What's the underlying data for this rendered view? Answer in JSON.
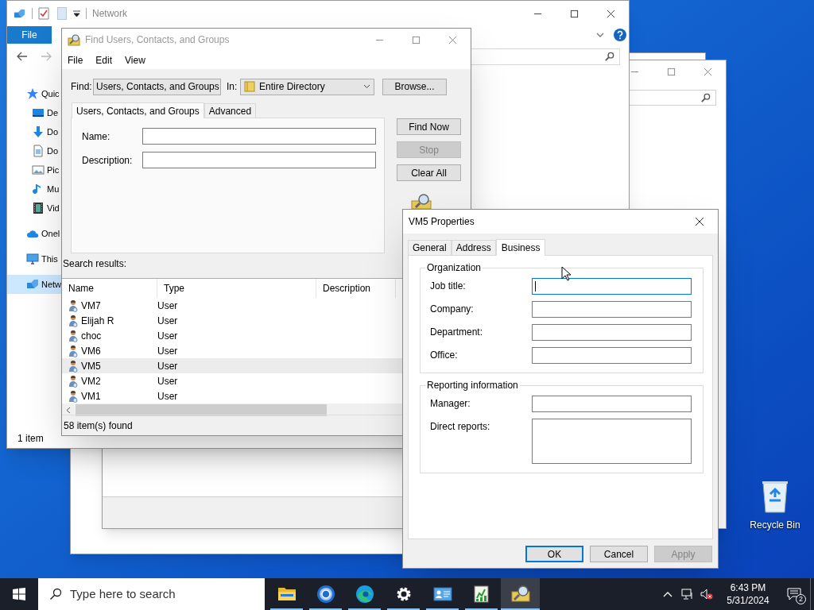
{
  "explorer": {
    "title": "Network",
    "ribbon_tab": "File",
    "status": "1 item",
    "sidebar": [
      {
        "label": "Quic",
        "kind": "star",
        "selected": false,
        "children": [
          {
            "label": "De",
            "kind": "desktop",
            "selected": false
          },
          {
            "label": "Do",
            "kind": "download",
            "selected": false
          },
          {
            "label": "Do",
            "kind": "document",
            "selected": false
          },
          {
            "label": "Pic",
            "kind": "pictures",
            "selected": false
          },
          {
            "label": "Mu",
            "kind": "music",
            "selected": false
          },
          {
            "label": "Vid",
            "kind": "videos",
            "selected": false
          }
        ]
      },
      {
        "label": "Onel",
        "kind": "cloud",
        "selected": false
      },
      {
        "label": "This",
        "kind": "pc",
        "selected": false
      },
      {
        "label": "Netw",
        "kind": "network",
        "selected": true
      }
    ]
  },
  "find_dialog": {
    "title": "Find Users, Contacts, and Groups",
    "menu": [
      "File",
      "Edit",
      "View"
    ],
    "find_label": "Find:",
    "find_value": "Users, Contacts, and Groups",
    "in_label": "In:",
    "in_value": "Entire Directory",
    "browse": "Browse...",
    "tabs": [
      {
        "label": "Users, Contacts, and Groups",
        "selected": true
      },
      {
        "label": "Advanced",
        "selected": false
      }
    ],
    "fields": [
      {
        "label": "Name:"
      },
      {
        "label": "Description:"
      }
    ],
    "buttons": [
      {
        "label": "Find Now",
        "disabled": false
      },
      {
        "label": "Stop",
        "disabled": true
      },
      {
        "label": "Clear All",
        "disabled": false
      }
    ],
    "results_label": "Search results:",
    "columns": [
      "Name",
      "Type",
      "Description"
    ],
    "rows": [
      {
        "name": "VM7",
        "type": "User",
        "selected": false
      },
      {
        "name": "Elijah R",
        "type": "User",
        "selected": false
      },
      {
        "name": "choc",
        "type": "User",
        "selected": false
      },
      {
        "name": "VM6",
        "type": "User",
        "selected": false
      },
      {
        "name": "VM5",
        "type": "User",
        "selected": true
      },
      {
        "name": "VM2",
        "type": "User",
        "selected": false
      },
      {
        "name": "VM1",
        "type": "User",
        "selected": false
      }
    ],
    "status": "58 item(s) found"
  },
  "properties_dialog": {
    "title": "VM5 Properties",
    "tabs": [
      {
        "label": "General",
        "selected": false
      },
      {
        "label": "Address",
        "selected": false
      },
      {
        "label": "Business",
        "selected": true
      }
    ],
    "groups": [
      {
        "title": "Organization",
        "fields": [
          {
            "label": "Job title:",
            "kind": "line",
            "focused": true
          },
          {
            "label": "Company:",
            "kind": "line",
            "focused": false
          },
          {
            "label": "Department:",
            "kind": "line",
            "focused": false
          },
          {
            "label": "Office:",
            "kind": "line",
            "focused": false
          }
        ]
      },
      {
        "title": "Reporting information",
        "fields": [
          {
            "label": "Manager:",
            "kind": "line",
            "focused": false
          },
          {
            "label": "Direct reports:",
            "kind": "multiline",
            "focused": false
          }
        ]
      }
    ],
    "buttons": [
      {
        "label": "OK",
        "default": true,
        "disabled": false
      },
      {
        "label": "Cancel",
        "default": false,
        "disabled": false
      },
      {
        "label": "Apply",
        "default": false,
        "disabled": true
      }
    ]
  },
  "desktop_icons": [
    {
      "label": "Recycle Bin"
    }
  ],
  "taskbar": {
    "search_placeholder": "Type here to search",
    "apps": [
      {
        "kind": "folder",
        "active": false
      },
      {
        "kind": "chrome",
        "active": false
      },
      {
        "kind": "edge",
        "active": false
      },
      {
        "kind": "settings",
        "active": false
      },
      {
        "kind": "card",
        "active": false
      },
      {
        "kind": "notepad",
        "active": false
      },
      {
        "kind": "finder",
        "active": true
      }
    ],
    "time": "6:43 PM",
    "date": "5/31/2024",
    "notification_count": "2"
  }
}
